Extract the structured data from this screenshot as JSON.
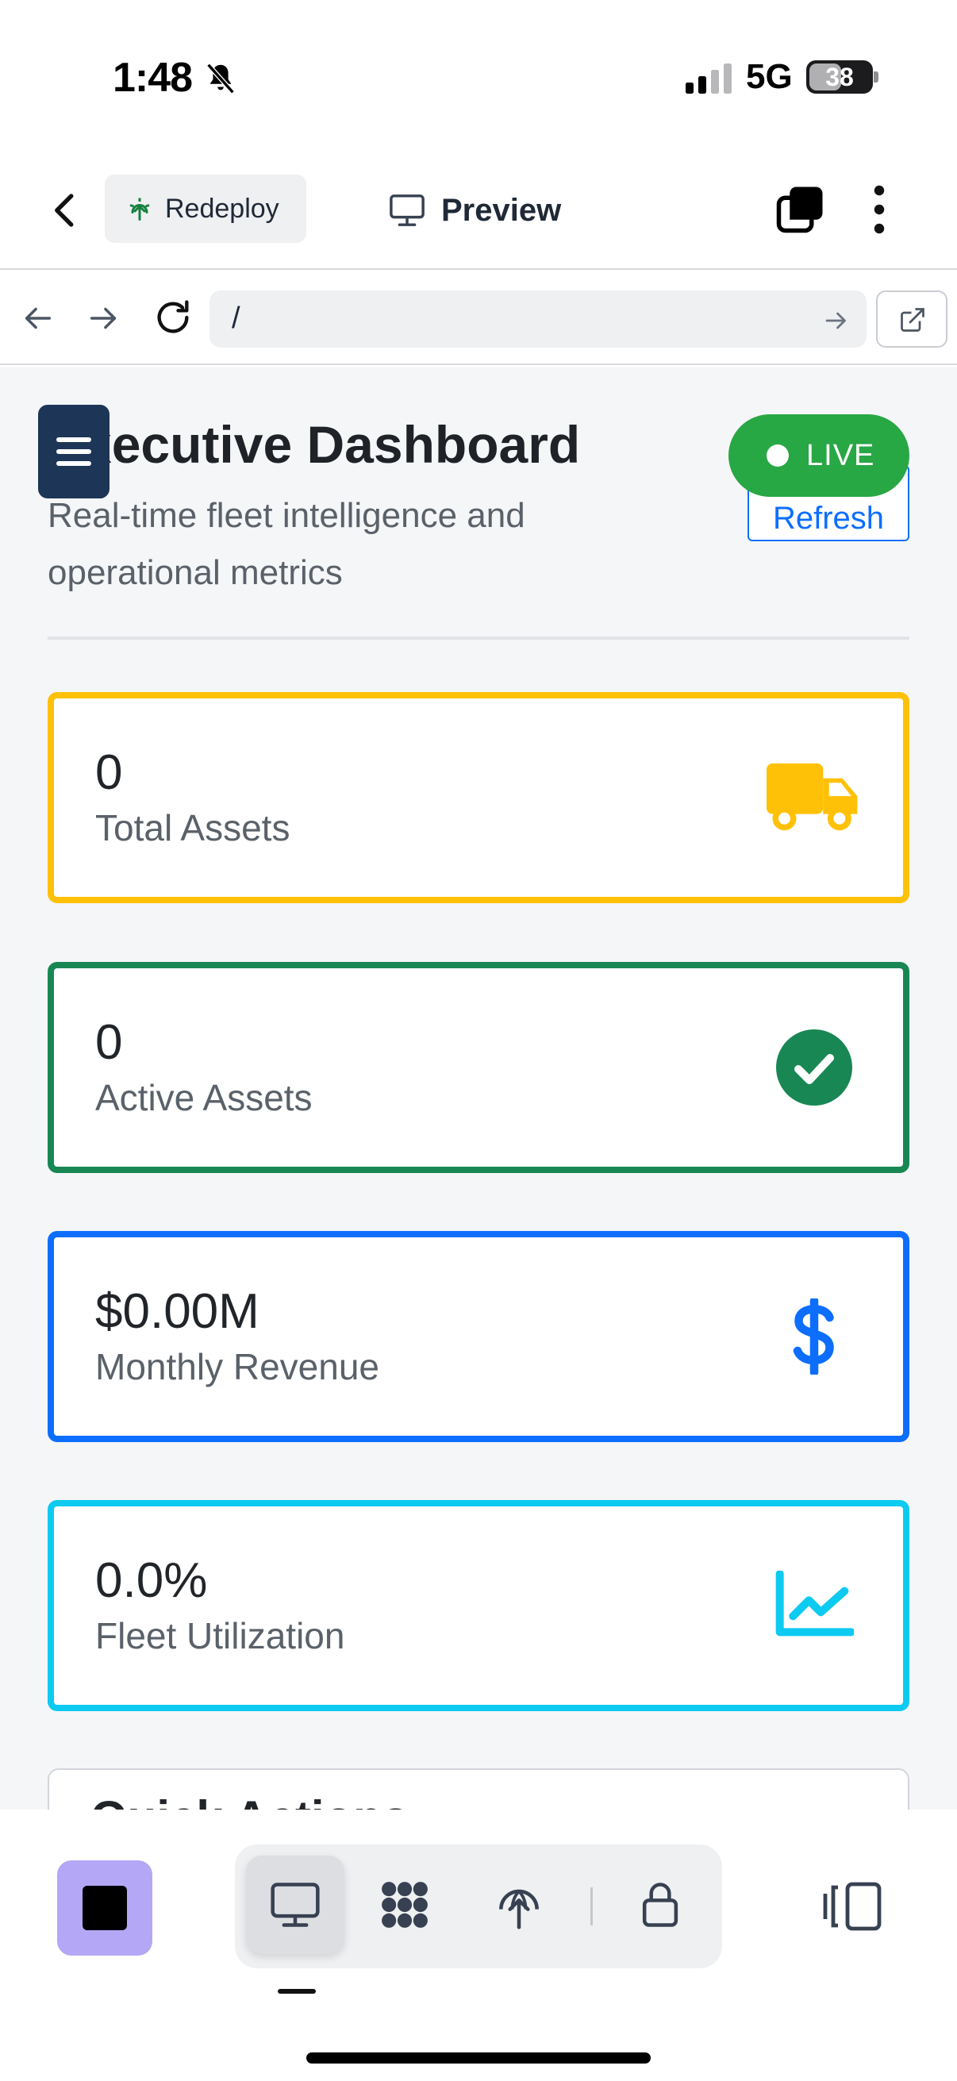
{
  "status_bar": {
    "time": "1:48",
    "network": "5G",
    "battery": "38"
  },
  "header": {
    "redeploy_label": "Redeploy",
    "preview_label": "Preview"
  },
  "browser": {
    "url": "/"
  },
  "dashboard": {
    "title": "Executive Dashboard",
    "subtitle": "Real-time fleet intelligence and operational metrics",
    "live_label": "LIVE",
    "refresh_label": "Refresh",
    "stats": [
      {
        "value": "0",
        "label": "Total Assets",
        "icon": "truck-icon",
        "color": "#ffc107"
      },
      {
        "value": "0",
        "label": "Active Assets",
        "icon": "check-circle-icon",
        "color": "#198754"
      },
      {
        "value": "$0.00M",
        "label": "Monthly Revenue",
        "icon": "dollar-icon",
        "color": "#0d6efd"
      },
      {
        "value": "0.0%",
        "label": "Fleet Utilization",
        "icon": "chart-line-icon",
        "color": "#0dcaf0"
      }
    ],
    "quick_actions_title": "Quick Actions"
  },
  "colors": {
    "live": "#28a745",
    "primary": "#0d6efd",
    "menu": "#1d3557",
    "stop": "#b4a7f5"
  }
}
